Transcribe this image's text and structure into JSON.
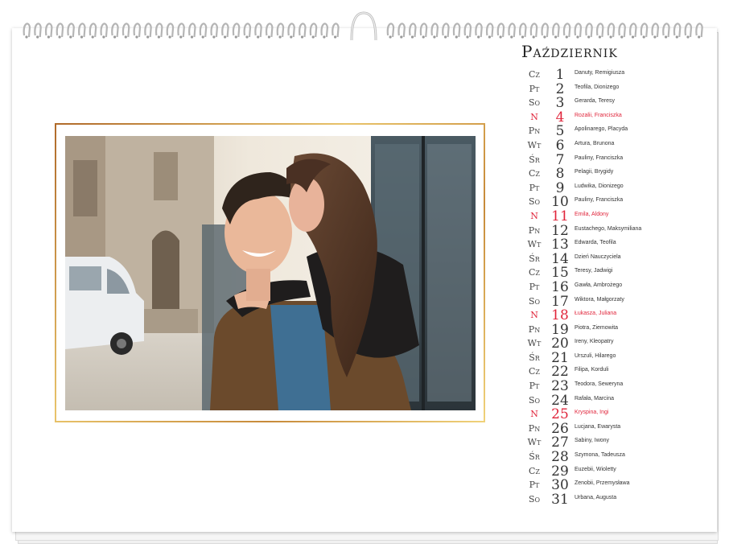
{
  "calendar": {
    "month": "Październik",
    "accent_color": "#e0253b",
    "days": [
      {
        "dow": "Cz",
        "num": "1",
        "names": "Danuty, Remigiusza",
        "sunday": false
      },
      {
        "dow": "Pt",
        "num": "2",
        "names": "Teofila, Dionizego",
        "sunday": false
      },
      {
        "dow": "So",
        "num": "3",
        "names": "Gerarda, Teresy",
        "sunday": false
      },
      {
        "dow": "N",
        "num": "4",
        "names": "Rozalii, Franciszka",
        "sunday": true
      },
      {
        "dow": "Pn",
        "num": "5",
        "names": "Apolinarego, Placyda",
        "sunday": false
      },
      {
        "dow": "Wt",
        "num": "6",
        "names": "Artura, Brunona",
        "sunday": false
      },
      {
        "dow": "Śr",
        "num": "7",
        "names": "Pauliny, Franciszka",
        "sunday": false
      },
      {
        "dow": "Cz",
        "num": "8",
        "names": "Pelagii, Brygidy",
        "sunday": false
      },
      {
        "dow": "Pt",
        "num": "9",
        "names": "Ludwika, Dionizego",
        "sunday": false
      },
      {
        "dow": "So",
        "num": "10",
        "names": "Pauliny, Franciszka",
        "sunday": false
      },
      {
        "dow": "N",
        "num": "11",
        "names": "Emila, Aldony",
        "sunday": true
      },
      {
        "dow": "Pn",
        "num": "12",
        "names": "Eustachego, Maksymiliana",
        "sunday": false
      },
      {
        "dow": "Wt",
        "num": "13",
        "names": "Edwarda, Teofila",
        "sunday": false
      },
      {
        "dow": "Śr",
        "num": "14",
        "names": "Dzień Nauczyciela",
        "sunday": false
      },
      {
        "dow": "Cz",
        "num": "15",
        "names": "Teresy, Jadwigi",
        "sunday": false
      },
      {
        "dow": "Pt",
        "num": "16",
        "names": "Gawła, Ambrożego",
        "sunday": false
      },
      {
        "dow": "So",
        "num": "17",
        "names": "Wiktora, Małgorzaty",
        "sunday": false
      },
      {
        "dow": "N",
        "num": "18",
        "names": "Łukasza, Juliana",
        "sunday": true
      },
      {
        "dow": "Pn",
        "num": "19",
        "names": "Piotra, Ziemowita",
        "sunday": false
      },
      {
        "dow": "Wt",
        "num": "20",
        "names": "Ireny, Kleopatry",
        "sunday": false
      },
      {
        "dow": "Śr",
        "num": "21",
        "names": "Urszuli, Hilarego",
        "sunday": false
      },
      {
        "dow": "Cz",
        "num": "22",
        "names": "Filipa, Korduli",
        "sunday": false
      },
      {
        "dow": "Pt",
        "num": "23",
        "names": "Teodora, Seweryna",
        "sunday": false
      },
      {
        "dow": "So",
        "num": "24",
        "names": "Rafała, Marcina",
        "sunday": false
      },
      {
        "dow": "N",
        "num": "25",
        "names": "Kryspina, Ingi",
        "sunday": true
      },
      {
        "dow": "Pn",
        "num": "26",
        "names": "Lucjana, Ewarysta",
        "sunday": false
      },
      {
        "dow": "Wt",
        "num": "27",
        "names": "Sabiny, Iwony",
        "sunday": false
      },
      {
        "dow": "Śr",
        "num": "28",
        "names": "Szymona, Tadeusza",
        "sunday": false
      },
      {
        "dow": "Cz",
        "num": "29",
        "names": "Euzebii, Wioletty",
        "sunday": false
      },
      {
        "dow": "Pt",
        "num": "30",
        "names": "Zenobii, Przemysława",
        "sunday": false
      },
      {
        "dow": "So",
        "num": "31",
        "names": "Urbana, Augusta",
        "sunday": false
      }
    ]
  },
  "photo": {
    "subject": "couple-piggyback-photo"
  }
}
